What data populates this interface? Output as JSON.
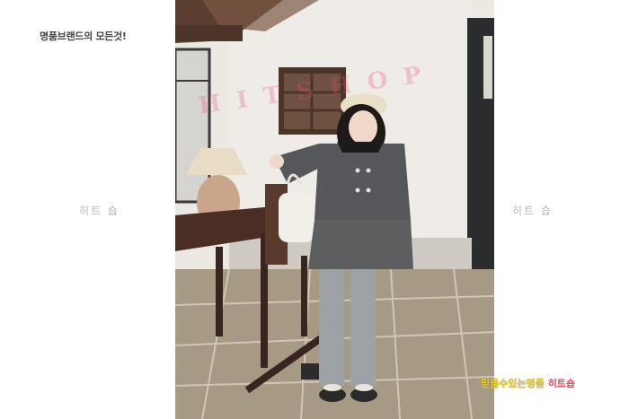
{
  "tagline": "명품브랜드의 모든것!",
  "side_watermark_left": "히트 숍",
  "side_watermark_right": "히트 숍",
  "photo_watermark": "HITSHOP",
  "footer": {
    "slogan": "믿을수있는명품",
    "brand": "히트숍"
  },
  "colors": {
    "slogan": "#f3d21a",
    "brand": "#e8475c",
    "watermark": "#f0506e"
  }
}
